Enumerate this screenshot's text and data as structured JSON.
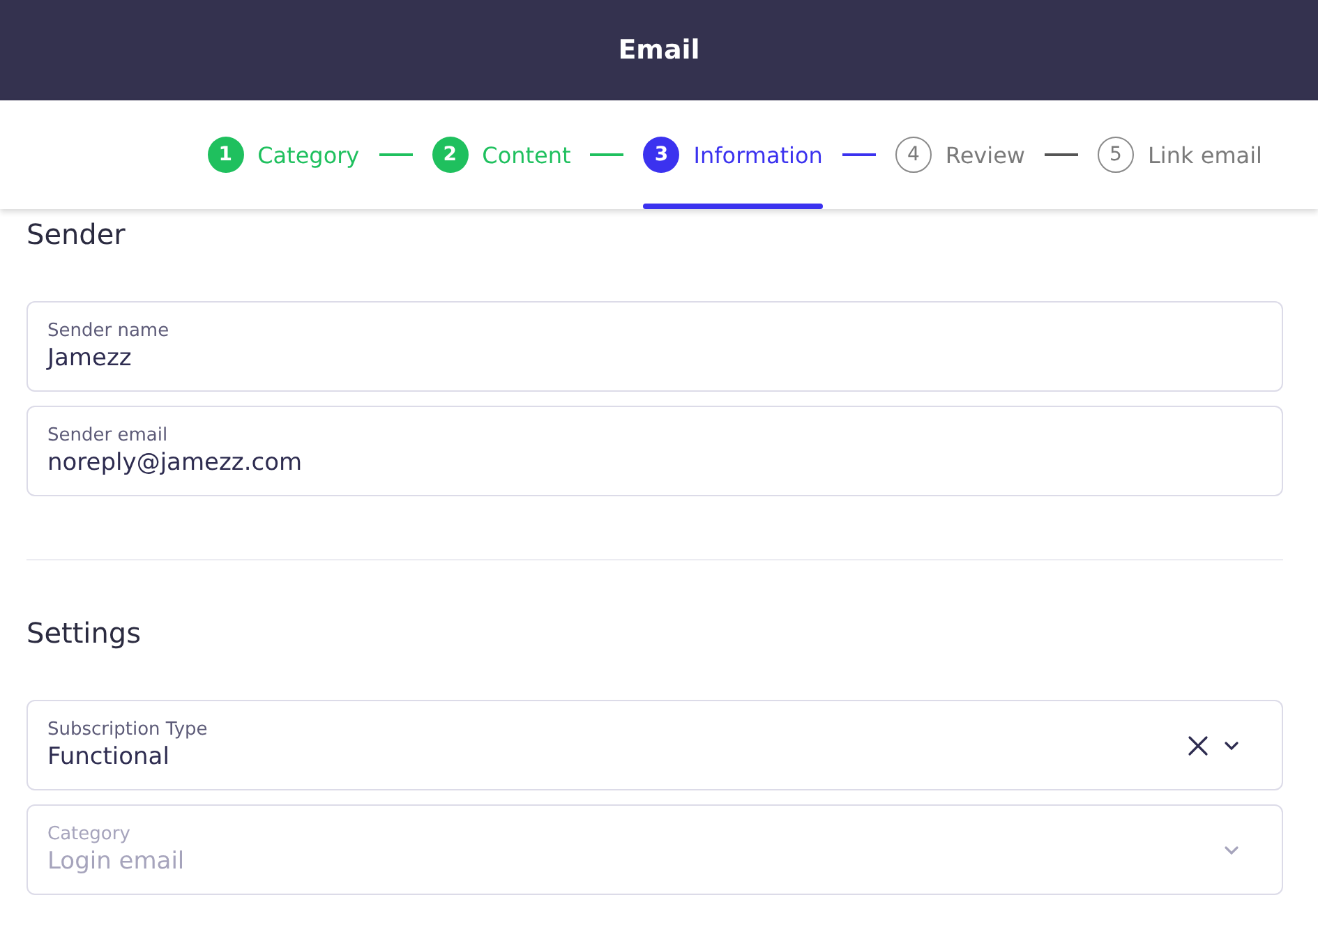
{
  "header": {
    "title": "Email"
  },
  "steps": [
    {
      "number": "1",
      "label": "Category",
      "completed": true,
      "selected": false
    },
    {
      "number": "2",
      "label": "Content",
      "completed": true,
      "selected": false
    },
    {
      "number": "3",
      "label": "Information",
      "completed": false,
      "selected": true
    },
    {
      "number": "4",
      "label": "Review",
      "completed": false,
      "selected": false
    },
    {
      "number": "5",
      "label": "Link email",
      "completed": false,
      "selected": false
    }
  ],
  "sections": [
    {
      "title": "Sender",
      "fields": [
        {
          "kind": "text",
          "label": "Sender name",
          "value": "Jamezz",
          "disabled": false
        },
        {
          "kind": "text",
          "label": "Sender email",
          "value": "noreply@jamezz.com",
          "disabled": false
        }
      ]
    },
    {
      "title": "Settings",
      "fields": [
        {
          "kind": "select",
          "label": "Subscription Type",
          "value": "Functional",
          "clearable": true,
          "disabled": false
        },
        {
          "kind": "select",
          "label": "Category",
          "value": "Login email",
          "clearable": false,
          "disabled": true
        }
      ]
    }
  ]
}
